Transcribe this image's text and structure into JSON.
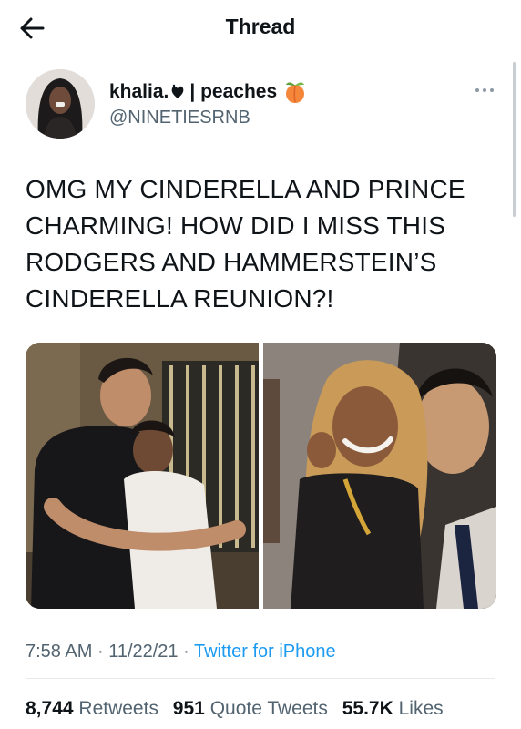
{
  "header": {
    "title": "Thread"
  },
  "author": {
    "display_name": "khalia.",
    "name_separator": "| peaches",
    "handle": "@NINETIESRNB"
  },
  "tweet": {
    "text": "OMG MY CINDERELLA AND PRINCE CHARMING! HOW DID I MISS THIS RODGERS AND HAMMERSTEIN’S CINDERELLA REUNION?!",
    "time": "7:58 AM",
    "dot1": "·",
    "date": "11/22/21",
    "dot2": "·",
    "source": "Twitter for iPhone"
  },
  "stats": {
    "retweets_count": "8,744",
    "retweets_label": "Retweets",
    "quotes_count": "951",
    "quotes_label": "Quote Tweets",
    "likes_count": "55.7K",
    "likes_label": "Likes"
  },
  "icons": {
    "back": "arrow-left-icon",
    "more": "more-horizontal-icon",
    "heart": "heart-emoji-icon",
    "peach": "peach-emoji-icon"
  },
  "colors": {
    "link": "#1d9bf0",
    "secondary_text": "#536471",
    "text": "#0f1419"
  }
}
